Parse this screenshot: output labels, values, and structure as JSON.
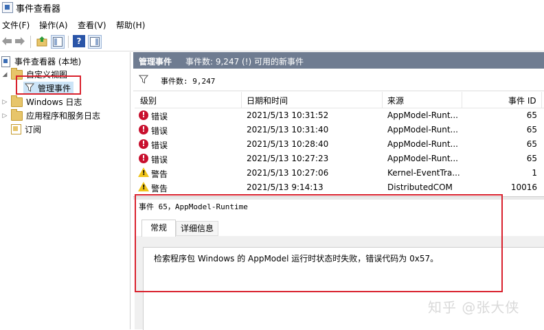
{
  "window": {
    "title": "事件查看器"
  },
  "menu": [
    "文件(F)",
    "操作(A)",
    "查看(V)",
    "帮助(H)"
  ],
  "tree": {
    "root": "事件查看器 (本地)",
    "custom_views": "自定义视图",
    "admin_events": "管理事件",
    "windows_logs": "Windows 日志",
    "app_service_logs": "应用程序和服务日志",
    "subscriptions": "订阅"
  },
  "pane": {
    "title": "管理事件",
    "summary": "事件数: 9,247 (!) 可用的新事件",
    "filter_text": "事件数: 9,247"
  },
  "columns": [
    "级别",
    "日期和时间",
    "来源",
    "事件 ID"
  ],
  "events": [
    {
      "level": "错误",
      "type": "error",
      "datetime": "2021/5/13 10:31:52",
      "source": "AppModel-Runt...",
      "id": "65"
    },
    {
      "level": "错误",
      "type": "error",
      "datetime": "2021/5/13 10:31:40",
      "source": "AppModel-Runt...",
      "id": "65"
    },
    {
      "level": "错误",
      "type": "error",
      "datetime": "2021/5/13 10:28:40",
      "source": "AppModel-Runt...",
      "id": "65"
    },
    {
      "level": "错误",
      "type": "error",
      "datetime": "2021/5/13 10:27:23",
      "source": "AppModel-Runt...",
      "id": "65"
    },
    {
      "level": "警告",
      "type": "warning",
      "datetime": "2021/5/13 10:27:06",
      "source": "Kernel-EventTra...",
      "id": "1"
    },
    {
      "level": "警告",
      "type": "warning",
      "datetime": "2021/5/13 9:14:13",
      "source": "DistributedCOM",
      "id": "10016"
    }
  ],
  "detail": {
    "title": "事件 65，AppModel-Runtime",
    "tabs": [
      "常规",
      "详细信息"
    ],
    "message": "检索程序包 Windows 的 AppModel 运行时状态时失败，错误代码为 0x57。"
  },
  "watermark": "知乎 @张大侠",
  "colors": {
    "header": "#6f7c91",
    "highlight": "#d9202c",
    "error": "#c8102e",
    "warning": "#f0c419"
  },
  "icons": [
    "app-icon",
    "back-arrow-icon",
    "forward-arrow-icon",
    "folder-up-icon",
    "show-tree-icon",
    "help-icon",
    "action-pane-icon",
    "filter-icon",
    "folder-icon",
    "log-icon",
    "error-icon",
    "warning-icon"
  ]
}
